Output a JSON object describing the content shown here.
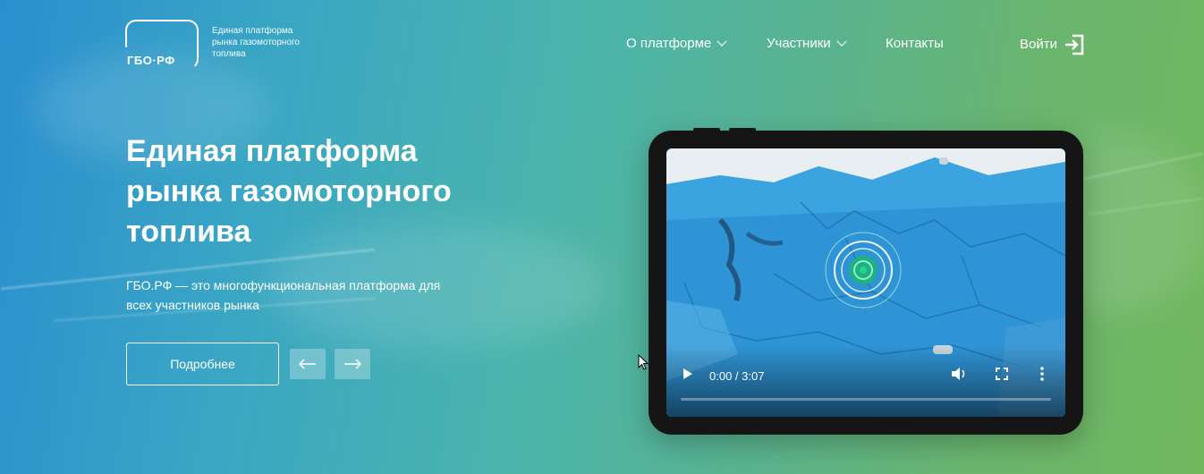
{
  "logo": {
    "text": "ГБО·РФ",
    "caption": "Единая платформа рынка газомоторного топлива"
  },
  "nav": {
    "items": [
      {
        "label": "О платформе",
        "has_dropdown": true
      },
      {
        "label": "Участники",
        "has_dropdown": true
      },
      {
        "label": "Контакты",
        "has_dropdown": false
      }
    ],
    "login_label": "Войти"
  },
  "hero": {
    "title": "Единая платформа рынка газомоторного топлива",
    "description": "ГБО.РФ — это многофункциональная платформа для всех участников рынка",
    "more_button": "Подробнее"
  },
  "video": {
    "time": "0:00 / 3:07",
    "progress": 0
  },
  "colors": {
    "gradient_start": "#2a8fcf",
    "gradient_end": "#72b85e",
    "tablet": "#151515",
    "map_blue": "#2c8fd1",
    "accent_green": "#28d48a"
  }
}
